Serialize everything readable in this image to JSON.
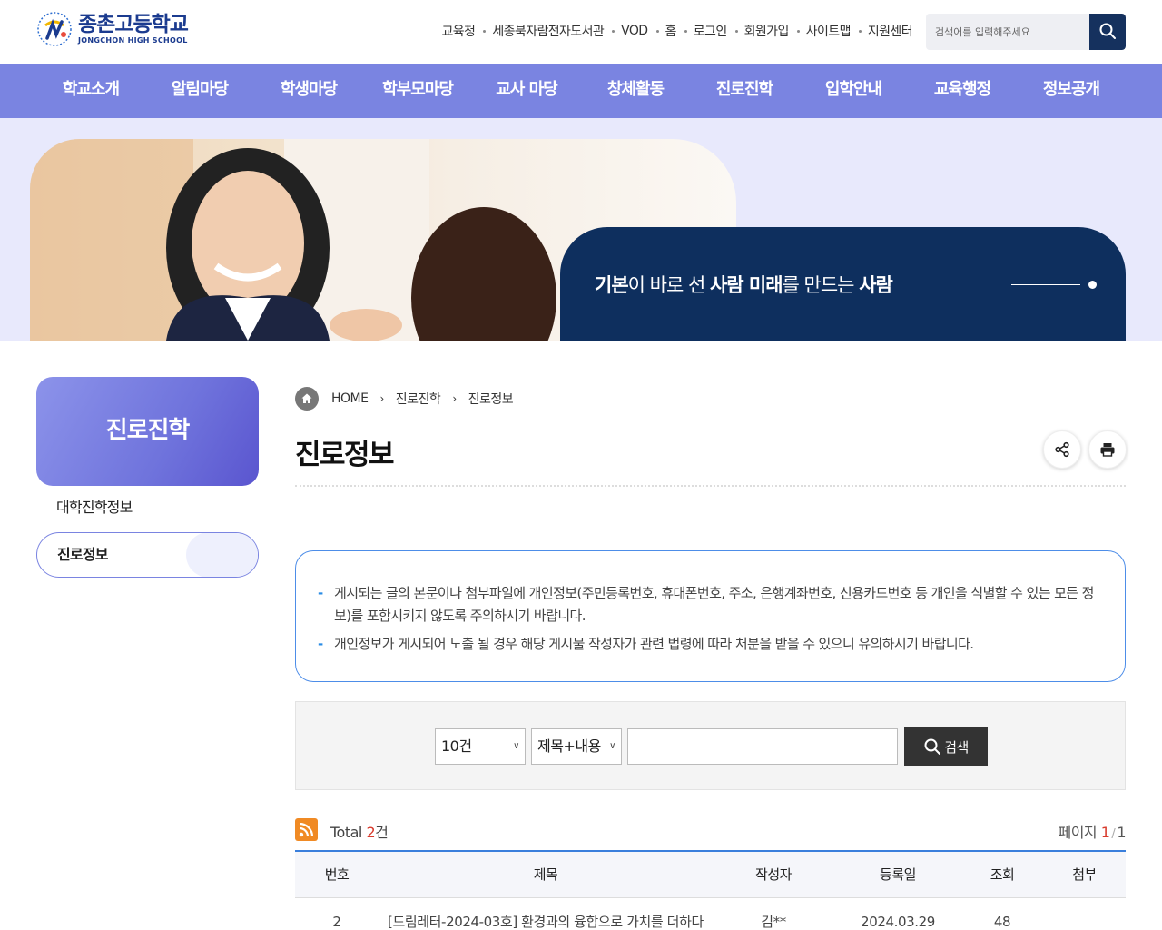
{
  "logo": {
    "name_ko": "종촌고등학교",
    "name_en": "JONGCHON HIGH SCHOOL"
  },
  "util_links": [
    "교육청",
    "세종북자람전자도서관",
    "VOD",
    "홈",
    "로그인",
    "회원가입",
    "사이트맵",
    "지원센터"
  ],
  "search": {
    "placeholder": "검색어를 입력해주세요"
  },
  "gnb": [
    "학교소개",
    "알림마당",
    "학생마당",
    "학부모마당",
    "교사 마당",
    "창체활동",
    "진로진학",
    "입학안내",
    "교육행정",
    "정보공개"
  ],
  "visual": {
    "slogan_b1": "기본",
    "slogan_1": "이 바로 선 ",
    "slogan_b2": "사람 미래",
    "slogan_2": "를 만드는 ",
    "slogan_b3": "사람"
  },
  "lnb": {
    "title": "진로진학",
    "items": [
      "대학진학정보",
      "진로정보"
    ]
  },
  "breadcrumb": [
    "HOME",
    "진로진학",
    "진로정보"
  ],
  "page_title": "진로정보",
  "notice": [
    "게시되는 글의 본문이나 첨부파일에 개인정보(주민등록번호, 휴대폰번호, 주소, 은행계좌번호, 신용카드번호 등 개인을 식별할 수 있는 모든 정보)를 포함시키지 않도록 주의하시기 바랍니다.",
    "개인정보가 게시되어 노출 될 경우 해당 게시물 작성자가 관련 법령에 따라 처분을 받을 수 있으니 유의하시기 바랍니다."
  ],
  "board_search": {
    "count_option": "10건",
    "field_option": "제목+내용",
    "keyword": "",
    "button": "검색"
  },
  "summary": {
    "total_label": "Total ",
    "total_count": "2",
    "total_unit": "건",
    "page_label": "페이지 ",
    "page_current": "1",
    "page_total": "1"
  },
  "table": {
    "headers": [
      "번호",
      "제목",
      "작성자",
      "등록일",
      "조회",
      "첨부"
    ],
    "rows": [
      {
        "no": "2",
        "title": "[드림레터-2024-03호] 환경과의 융합으로 가치를 더하다",
        "author": "김**",
        "date": "2024.03.29",
        "views": "48",
        "attach": ""
      }
    ]
  },
  "colors": {
    "gnb": "#7a84e1",
    "banner": "#0e2f5e",
    "accent_blue": "#3a7fdc",
    "count_red": "#d83a2c"
  }
}
